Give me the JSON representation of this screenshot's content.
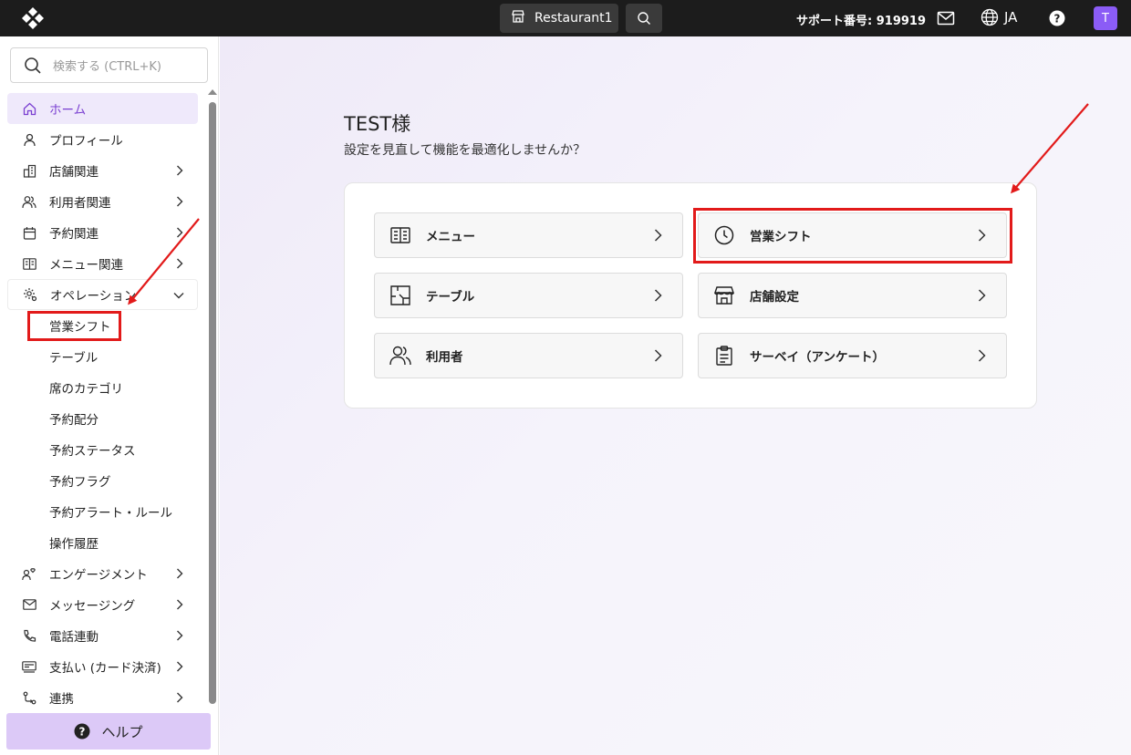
{
  "topbar": {
    "restaurant": "Restaurant1",
    "support": "サポート番号: 919919",
    "language": "JA",
    "avatar_initial": "T",
    "logo_icon": "app-logo-icon"
  },
  "sidebar": {
    "search_placeholder": "検索する (CTRL+K)",
    "items": [
      {
        "label": "ホーム",
        "icon": "home-icon"
      },
      {
        "label": "プロフィール",
        "icon": "user-icon"
      },
      {
        "label": "店舗関連",
        "icon": "building-icon"
      },
      {
        "label": "利用者関連",
        "icon": "users-icon"
      },
      {
        "label": "予約関連",
        "icon": "calendar-icon"
      },
      {
        "label": "メニュー関連",
        "icon": "menu-list-icon"
      },
      {
        "label": "オペレーション",
        "icon": "operation-gear-icon"
      }
    ],
    "sub_items": [
      "営業シフト",
      "テーブル",
      "席のカテゴリ",
      "予約配分",
      "予約ステータス",
      "予約フラグ",
      "予約アラート・ルール",
      "操作履歴"
    ],
    "items_after": [
      {
        "label": "エンゲージメント",
        "icon": "engagement-icon"
      },
      {
        "label": "メッセージング",
        "icon": "mail-icon"
      },
      {
        "label": "電話連動",
        "icon": "phone-icon"
      },
      {
        "label": "支払い (カード決済)",
        "icon": "payment-icon"
      },
      {
        "label": "連携",
        "icon": "integration-icon"
      }
    ],
    "help_label": "ヘルプ"
  },
  "main": {
    "greeting": "TEST様",
    "subtitle": "設定を見直して機能を最適化しませんか？",
    "tiles": [
      {
        "label": "メニュー",
        "icon": "book-icon"
      },
      {
        "label": "営業シフト",
        "icon": "clock-icon"
      },
      {
        "label": "テーブル",
        "icon": "floor-plan-icon"
      },
      {
        "label": "店舗設定",
        "icon": "store-icon"
      },
      {
        "label": "利用者",
        "icon": "users-icon"
      },
      {
        "label": "サーベイ（アンケート）",
        "icon": "clipboard-icon"
      }
    ]
  },
  "colors": {
    "accent": "#7a3fd1",
    "highlight": "#e21a1a",
    "topbar_bg": "#1c1c1c",
    "help_bg": "#dcc9f7"
  }
}
